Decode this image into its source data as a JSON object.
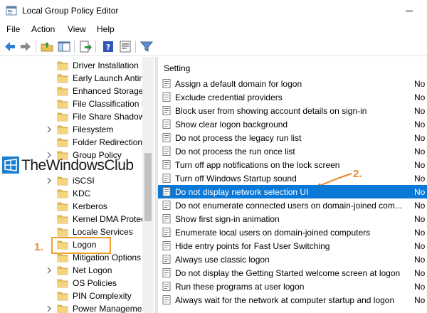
{
  "window": {
    "title": "Local Group Policy Editor"
  },
  "menu": [
    "File",
    "Action",
    "View",
    "Help"
  ],
  "tree": {
    "items": [
      {
        "label": "Driver Installation",
        "expandable": false
      },
      {
        "label": "Early Launch Antin",
        "expandable": false
      },
      {
        "label": "Enhanced Storage",
        "expandable": false
      },
      {
        "label": "File Classification I",
        "expandable": false
      },
      {
        "label": "File Share Shadow",
        "expandable": false
      },
      {
        "label": "Filesystem",
        "expandable": true
      },
      {
        "label": "Folder Redirection",
        "expandable": false
      },
      {
        "label": "Group Policy",
        "expandable": true
      },
      {
        "label": "",
        "expandable": false
      },
      {
        "label": "iSCSI",
        "expandable": true
      },
      {
        "label": "KDC",
        "expandable": false
      },
      {
        "label": "Kerberos",
        "expandable": false
      },
      {
        "label": "Kernel DMA Protec",
        "expandable": false
      },
      {
        "label": "Locale Services",
        "expandable": false
      },
      {
        "label": "Logon",
        "expandable": false
      },
      {
        "label": "Mitigation Options",
        "expandable": false
      },
      {
        "label": "Net Logon",
        "expandable": true
      },
      {
        "label": "OS Policies",
        "expandable": false
      },
      {
        "label": "PIN Complexity",
        "expandable": false
      },
      {
        "label": "Power Manageme",
        "expandable": true
      }
    ]
  },
  "annotations": {
    "step1": "1.",
    "step2": "2."
  },
  "watermark": {
    "text": "TheWindowsClub"
  },
  "settings": {
    "header": "Setting",
    "rows": [
      {
        "name": "Assign a default domain for logon",
        "state": "No"
      },
      {
        "name": "Exclude credential providers",
        "state": "No"
      },
      {
        "name": "Block user from showing account details on sign-in",
        "state": "No"
      },
      {
        "name": "Show clear logon background",
        "state": "No"
      },
      {
        "name": "Do not process the legacy run list",
        "state": "No"
      },
      {
        "name": "Do not process the run once list",
        "state": "No"
      },
      {
        "name": "Turn off app notifications on the lock screen",
        "state": "No"
      },
      {
        "name": "Turn off Windows Startup sound",
        "state": "No"
      },
      {
        "name": "Do not display network selection UI",
        "state": "No",
        "selected": true
      },
      {
        "name": "Do not enumerate connected users on domain-joined com...",
        "state": "No"
      },
      {
        "name": "Show first sign-in animation",
        "state": "No"
      },
      {
        "name": "Enumerate local users on domain-joined computers",
        "state": "No"
      },
      {
        "name": "Hide entry points for Fast User Switching",
        "state": "No"
      },
      {
        "name": "Always use classic logon",
        "state": "No"
      },
      {
        "name": "Do not display the Getting Started welcome screen at logon",
        "state": "No"
      },
      {
        "name": "Run these programs at user logon",
        "state": "No"
      },
      {
        "name": "Always wait for the network at computer startup and logon",
        "state": "No"
      }
    ]
  },
  "colors": {
    "selection": "#0a78d7",
    "annotation": "#e8892a",
    "folder": "#e8c05a"
  }
}
